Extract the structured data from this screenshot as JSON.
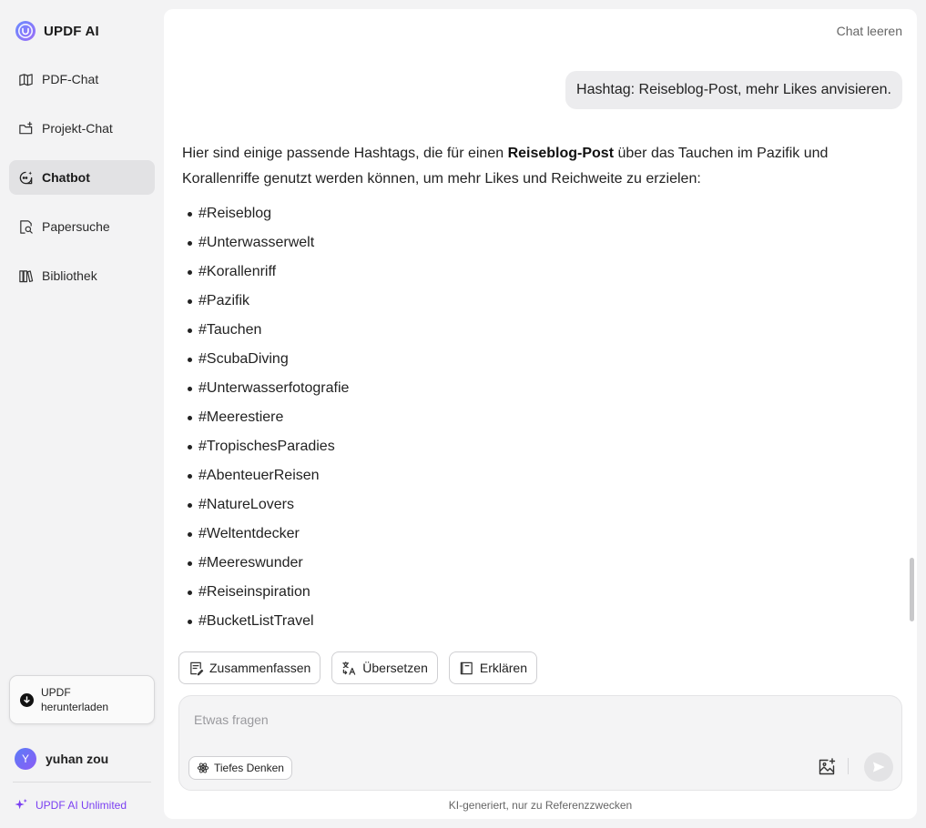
{
  "brand": {
    "name": "UPDF AI"
  },
  "sidebar": {
    "items": [
      {
        "label": "PDF-Chat",
        "icon": "book-open-icon"
      },
      {
        "label": "Projekt-Chat",
        "icon": "folder-plus-icon"
      },
      {
        "label": "Chatbot",
        "icon": "chatbot-icon",
        "active": true
      },
      {
        "label": "Papersuche",
        "icon": "paper-search-icon"
      },
      {
        "label": "Bibliothek",
        "icon": "library-icon"
      }
    ],
    "download": {
      "label": "UPDF herunterladen"
    },
    "user": {
      "initial": "Y",
      "name": "yuhan zou"
    },
    "upgrade": {
      "label": "UPDF AI Unlimited"
    }
  },
  "header": {
    "clear_label": "Chat leeren"
  },
  "chat": {
    "user_message": "Hashtag: Reiseblog-Post, mehr Likes anvisieren.",
    "answer": {
      "intro_before": "Hier sind einige passende Hashtags, die für einen ",
      "intro_bold": "Reiseblog-Post",
      "intro_after": " über das Tauchen im Pazifik und Korallenriffe genutzt werden können, um mehr Likes und Reichweite zu erzielen:",
      "hashtags": [
        "#Reiseblog",
        "#Unterwasserwelt",
        "#Korallenriff",
        "#Pazifik",
        "#Tauchen",
        "#ScubaDiving",
        "#Unterwasserfotografie",
        "#Meerestiere",
        "#TropischesParadies",
        "#AbenteuerReisen",
        "#NatureLovers",
        "#Weltentdecker",
        "#Meereswunder",
        "#Reiseinspiration",
        "#BucketListTravel"
      ]
    }
  },
  "actions": {
    "summarize": "Zusammenfassen",
    "translate": "Übersetzen",
    "explain": "Erklären"
  },
  "input": {
    "placeholder": "Etwas fragen",
    "value": "",
    "deep_think_label": "Tiefes Denken"
  },
  "footer": {
    "note": "KI-generiert, nur zu Referenzzwecken"
  },
  "colors": {
    "accent": "#7a3ff2",
    "active_nav": "#e2e2e4",
    "background": "#f3f3f4"
  }
}
